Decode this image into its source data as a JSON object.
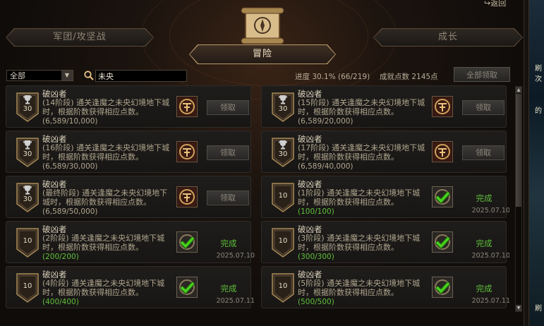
{
  "header": {
    "back_label": "返回",
    "tab_left": "军团/攻坚战",
    "tab_middle": "冒险",
    "tab_right": "成长"
  },
  "filter": {
    "select_value": "全部",
    "search_value": "未央",
    "progress": "进度  30.1% (66/219)",
    "points": "成就点数  2145点",
    "claim_all_label": "全部领取"
  },
  "side_strip": {
    "text_1": "刷",
    "text_2": "次",
    "text_3": "的",
    "text_4": "刷"
  },
  "cards": [
    {
      "title": "破凶者",
      "desc": "(14阶段) 通关逢魔之未央幻境地下城时，根据阶数获得相应点数。",
      "progress": "(6,589/10,000)",
      "badge": "30",
      "completed": false,
      "button": "领取",
      "status": "",
      "date": ""
    },
    {
      "title": "破凶者",
      "desc": "(15阶段) 通关逢魔之未央幻境地下城时，根据阶数获得相应点数。",
      "progress": "(6,589/20,000)",
      "badge": "30",
      "completed": false,
      "button": "领取",
      "status": "",
      "date": ""
    },
    {
      "title": "破凶者",
      "desc": "(16阶段) 通关逢魔之未央幻境地下城时，根据阶数获得相应点数。",
      "progress": "(6,589/30,000)",
      "badge": "30",
      "completed": false,
      "button": "领取",
      "status": "",
      "date": ""
    },
    {
      "title": "破凶者",
      "desc": "(17阶段) 通关逢魔之未央幻境地下城时，根据阶数获得相应点数。",
      "progress": "(6,589/40,000)",
      "badge": "30",
      "completed": false,
      "button": "领取",
      "status": "",
      "date": ""
    },
    {
      "title": "破凶者",
      "desc": "(最终阶段) 通关逢魔之未央幻境地下城时，根据阶数获得相应点数。",
      "progress": "(6,589/50,000)",
      "badge": "30",
      "completed": false,
      "button": "领取",
      "status": "",
      "date": ""
    },
    {
      "title": "破凶者",
      "desc": "(1阶段) 通关逢魔之未央幻境地下城时，根据阶数获得相应点数。",
      "progress": "(100/100)",
      "badge": "10",
      "completed": true,
      "button": "",
      "status": "完成",
      "date": "2025.07.10"
    },
    {
      "title": "破凶者",
      "desc": "(2阶段) 通关逢魔之未央幻境地下城时，根据阶数获得相应点数。",
      "progress": "(200/200)",
      "badge": "10",
      "completed": true,
      "button": "",
      "status": "完成",
      "date": "2025.07.10"
    },
    {
      "title": "破凶者",
      "desc": "(3阶段) 通关逢魔之未央幻境地下城时，根据阶数获得相应点数。",
      "progress": "(300/300)",
      "badge": "10",
      "completed": true,
      "button": "",
      "status": "完成",
      "date": "2025.07.10"
    },
    {
      "title": "破凶者",
      "desc": "(4阶段) 通关逢魔之未央幻境地下城时，根据阶数获得相应点数。",
      "progress": "(400/400)",
      "badge": "10",
      "completed": true,
      "button": "",
      "status": "完成",
      "date": "2025.07.11"
    },
    {
      "title": "破凶者",
      "desc": "(5阶段) 通关逢魔之未央幻境地下城时，根据阶数获得相应点数。",
      "progress": "(500/500)",
      "badge": "10",
      "completed": true,
      "button": "",
      "status": "完成",
      "date": "2025.07.11"
    }
  ],
  "icons": {
    "trophy": "trophy-icon",
    "search": "search-icon",
    "emblem": "achievement-emblem-icon",
    "check": "checkmark-icon"
  },
  "colors": {
    "completed_text": "#5fbf3c",
    "gold": "#c9a56a"
  }
}
